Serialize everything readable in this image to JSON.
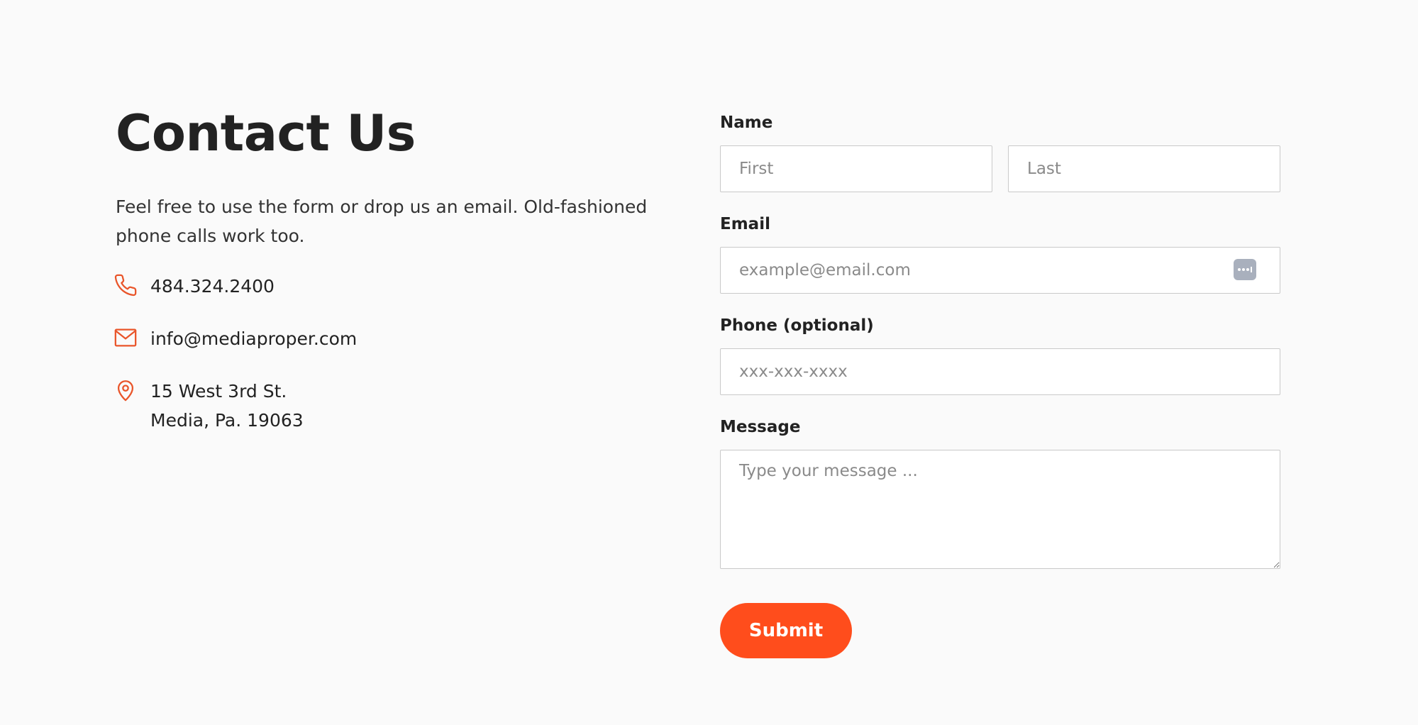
{
  "colors": {
    "accent": "#ff4d1c",
    "icon": "#e9552a",
    "background": "#fafafa",
    "text": "#222222"
  },
  "contact": {
    "title": "Contact Us",
    "intro": "Feel free to use the form or drop us an email. Old-fashioned phone calls work too.",
    "phone": {
      "icon": "phone-icon",
      "text": "484.324.2400"
    },
    "email": {
      "icon": "mail-icon",
      "text": "info@mediaproper.com"
    },
    "address": {
      "icon": "location-pin-icon",
      "line1": "15 West 3rd St.",
      "line2": "Media, Pa. 19063"
    }
  },
  "form": {
    "name": {
      "label": "Name",
      "first_placeholder": "First",
      "last_placeholder": "Last"
    },
    "email": {
      "label": "Email",
      "placeholder": "example@email.com",
      "autofill_icon": "password-manager-icon"
    },
    "phone": {
      "label": "Phone (optional)",
      "placeholder": "xxx-xxx-xxxx"
    },
    "message": {
      "label": "Message",
      "placeholder": "Type your message ..."
    },
    "submit_label": "Submit"
  }
}
